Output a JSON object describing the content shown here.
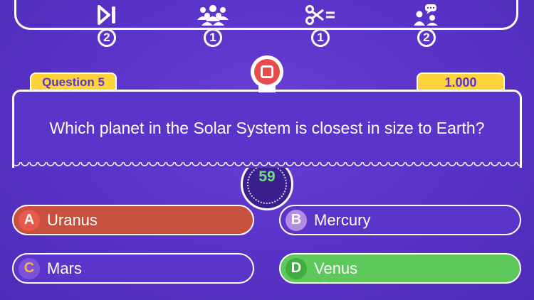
{
  "lifelines": [
    {
      "icon": "skip-icon",
      "count": "2"
    },
    {
      "icon": "audience-icon",
      "count": "1"
    },
    {
      "icon": "fifty-fifty-scissors-icon",
      "count": "1"
    },
    {
      "icon": "ask-friend-icon",
      "count": "2"
    }
  ],
  "question": {
    "label": "Question 5",
    "text": "Which planet in the Solar System is closest in size to Earth?",
    "score": "1.000"
  },
  "timer": {
    "value": "59"
  },
  "answers": [
    {
      "letter": "A",
      "text": "Uranus",
      "state": "wrong"
    },
    {
      "letter": "B",
      "text": "Mercury",
      "state": "neutral"
    },
    {
      "letter": "C",
      "text": "Mars",
      "state": "neutral"
    },
    {
      "letter": "D",
      "text": "Venus",
      "state": "correct"
    }
  ],
  "colors": {
    "background": "#5b34c9",
    "accent_yellow": "#ffd43b",
    "wrong_red": "#c7503f",
    "correct_green": "#5ec95a",
    "timer_green": "#6fe07a"
  }
}
